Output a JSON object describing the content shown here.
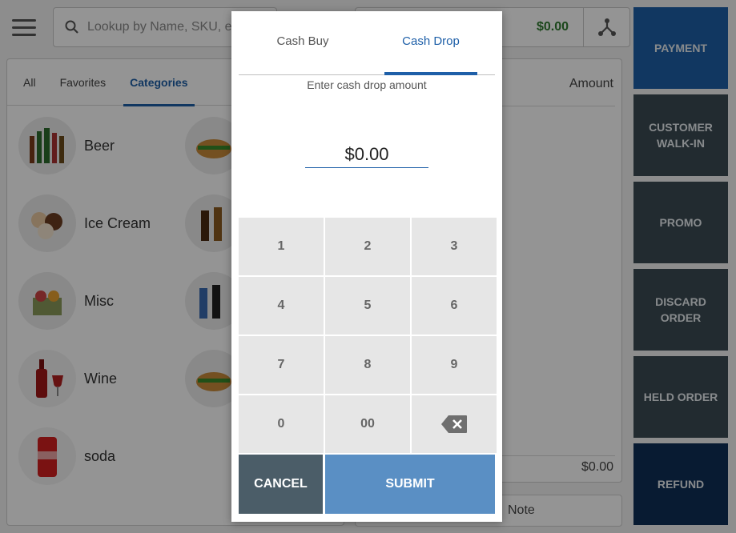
{
  "search": {
    "placeholder": "Lookup by Name, SKU, e"
  },
  "order": {
    "total": "$0.00",
    "amount_header": "Amount",
    "subtotal": "$0.00",
    "note_label": "Note"
  },
  "tabs": [
    {
      "label": "All"
    },
    {
      "label": "Favorites"
    },
    {
      "label": "Categories"
    }
  ],
  "categories": [
    {
      "label": "Beer"
    },
    {
      "label": "Ice Cream"
    },
    {
      "label": "Misc"
    },
    {
      "label": "Wine"
    },
    {
      "label": "soda"
    }
  ],
  "actions": [
    {
      "label": "PAYMENT"
    },
    {
      "label": "CUSTOMER WALK-IN"
    },
    {
      "label": "PROMO"
    },
    {
      "label": "DISCARD ORDER"
    },
    {
      "label": "HELD ORDER"
    },
    {
      "label": "REFUND"
    }
  ],
  "dialog": {
    "tabs": [
      {
        "label": "Cash Buy"
      },
      {
        "label": "Cash Drop"
      }
    ],
    "prompt": "Enter cash drop amount",
    "amount_value": "$0.00",
    "keys": [
      "1",
      "2",
      "3",
      "4",
      "5",
      "6",
      "7",
      "8",
      "9",
      "0",
      "00"
    ],
    "backspace_icon": "backspace-icon",
    "cancel_label": "CANCEL",
    "submit_label": "SUBMIT"
  },
  "colors": {
    "accent": "#1e5fa8",
    "action_dark": "#3b4a53",
    "submit": "#5a8fc4",
    "cancel": "#4b5d68",
    "total_green": "#2f7a2f"
  }
}
